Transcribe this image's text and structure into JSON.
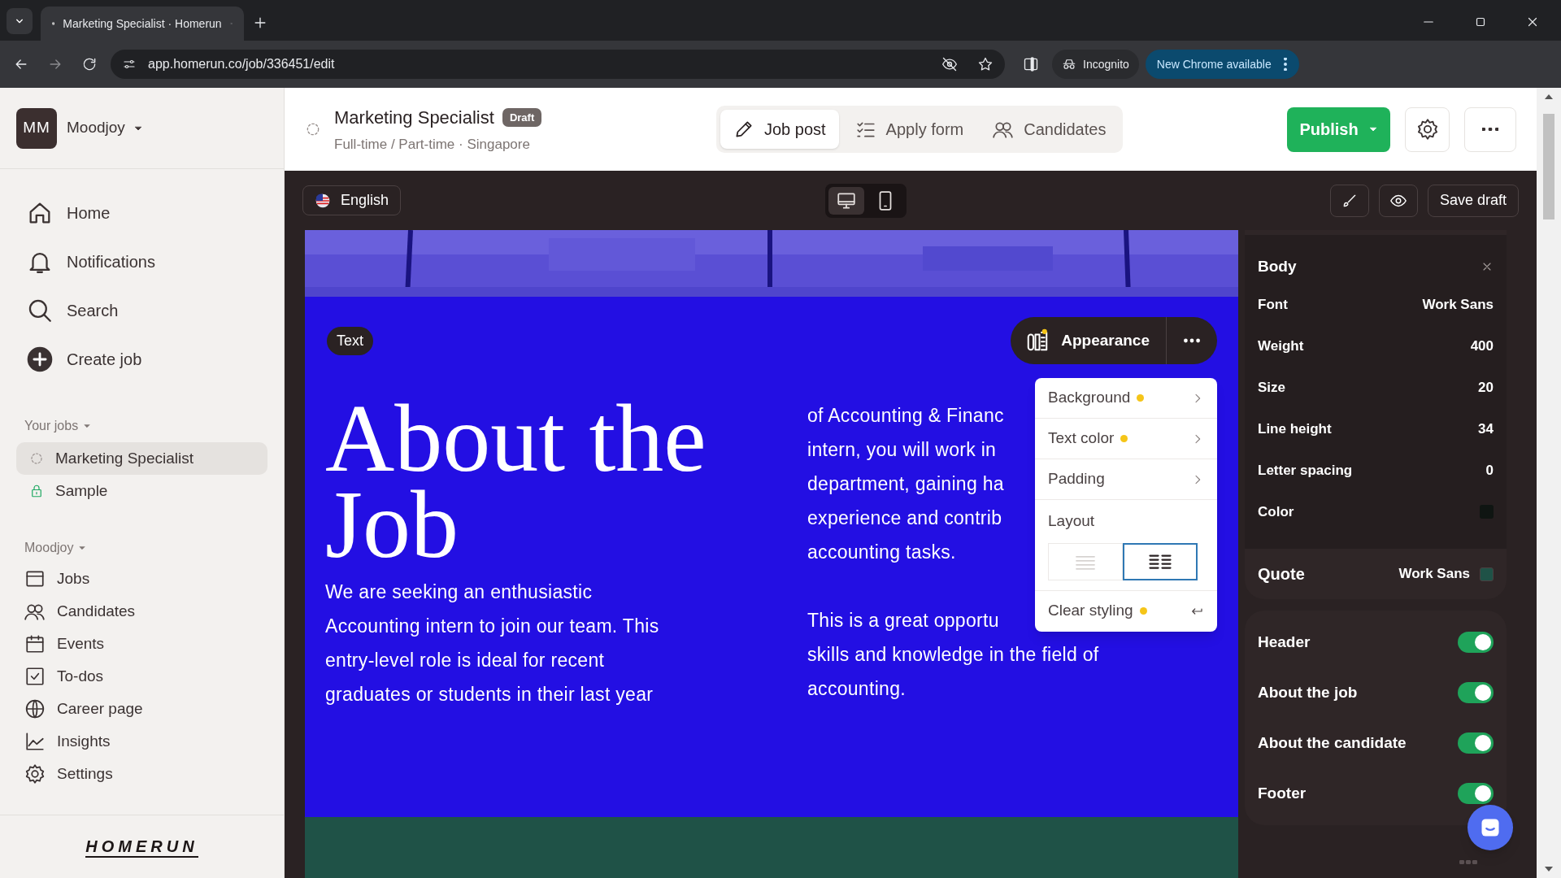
{
  "browser": {
    "tab_title": "Marketing Specialist · Homerun",
    "url": "app.homerun.co/job/336451/edit",
    "incognito": "Incognito",
    "update": "New Chrome available"
  },
  "sidebar": {
    "workspace": {
      "initials": "MM",
      "name": "Moodjoy"
    },
    "nav": [
      {
        "label": "Home",
        "kind": "home"
      },
      {
        "label": "Notifications",
        "kind": "bell"
      },
      {
        "label": "Search",
        "kind": "search"
      },
      {
        "label": "Create job",
        "kind": "plus"
      }
    ],
    "your_jobs": {
      "label": "Your jobs",
      "items": [
        {
          "label": "Marketing Specialist",
          "kind": "draft",
          "selected": true
        },
        {
          "label": "Sample",
          "kind": "lock",
          "selected": false
        }
      ]
    },
    "company": {
      "label": "Moodjoy",
      "items": [
        {
          "label": "Jobs",
          "kind": "window"
        },
        {
          "label": "Candidates",
          "kind": "people"
        },
        {
          "label": "Events",
          "kind": "calendar"
        },
        {
          "label": "To-dos",
          "kind": "check"
        },
        {
          "label": "Career page",
          "kind": "globe"
        },
        {
          "label": "Insights",
          "kind": "chart"
        },
        {
          "label": "Settings",
          "kind": "gear"
        }
      ]
    },
    "logo": "HOMERUN"
  },
  "header": {
    "title": "Marketing Specialist",
    "badge": "Draft",
    "subtitle": "Full-time / Part-time · Singapore",
    "tabs": [
      {
        "label": "Job post",
        "kind": "pencil",
        "selected": true
      },
      {
        "label": "Apply form",
        "kind": "list",
        "selected": false
      },
      {
        "label": "Candidates",
        "kind": "people",
        "selected": false
      }
    ],
    "publish": "Publish"
  },
  "toolbar": {
    "language": "English",
    "devices": [
      {
        "kind": "desktop",
        "selected": true
      },
      {
        "kind": "mobile",
        "selected": false
      }
    ],
    "save": "Save draft"
  },
  "canvas": {
    "block_label": "Text",
    "appearance": "Appearance",
    "heading": "About the Job",
    "paragraph": "We are seeking an enthusiastic Accounting intern to join our team. This entry-level role is ideal for recent graduates or students in their last year",
    "right_column": [
      [
        "of Accounting & Financ",
        "intern, you will work in",
        "department, gaining ha",
        "experience and contrib",
        "accounting tasks."
      ],
      [
        "This is a great opportu",
        "skills and knowledge in the field of",
        "accounting."
      ]
    ],
    "menu": [
      {
        "label": "Background",
        "kind": "submenu",
        "modified": true
      },
      {
        "label": "Text color",
        "kind": "submenu",
        "modified": true
      },
      {
        "label": "Padding",
        "kind": "submenu",
        "modified": false
      },
      {
        "label": "Layout",
        "kind": "layout",
        "options": [
          {
            "kind": "single",
            "selected": false
          },
          {
            "kind": "columns",
            "selected": true
          }
        ]
      },
      {
        "label": "Clear styling",
        "kind": "reset",
        "modified": true
      }
    ]
  },
  "panel": {
    "body": {
      "title": "Body",
      "rows": [
        {
          "label": "Font",
          "value": "Work Sans"
        },
        {
          "label": "Weight",
          "value": "400"
        },
        {
          "label": "Size",
          "value": "20"
        },
        {
          "label": "Line height",
          "value": "34"
        },
        {
          "label": "Letter spacing",
          "value": "0"
        },
        {
          "label": "Color",
          "color": "#0f1512"
        }
      ]
    },
    "quote": {
      "label": "Quote",
      "value": "Work Sans",
      "color": "#1f5247"
    },
    "sections": [
      {
        "label": "Header",
        "on": true
      },
      {
        "label": "About the job",
        "on": true
      },
      {
        "label": "About the candidate",
        "on": true
      },
      {
        "label": "Footer",
        "on": true
      }
    ]
  }
}
